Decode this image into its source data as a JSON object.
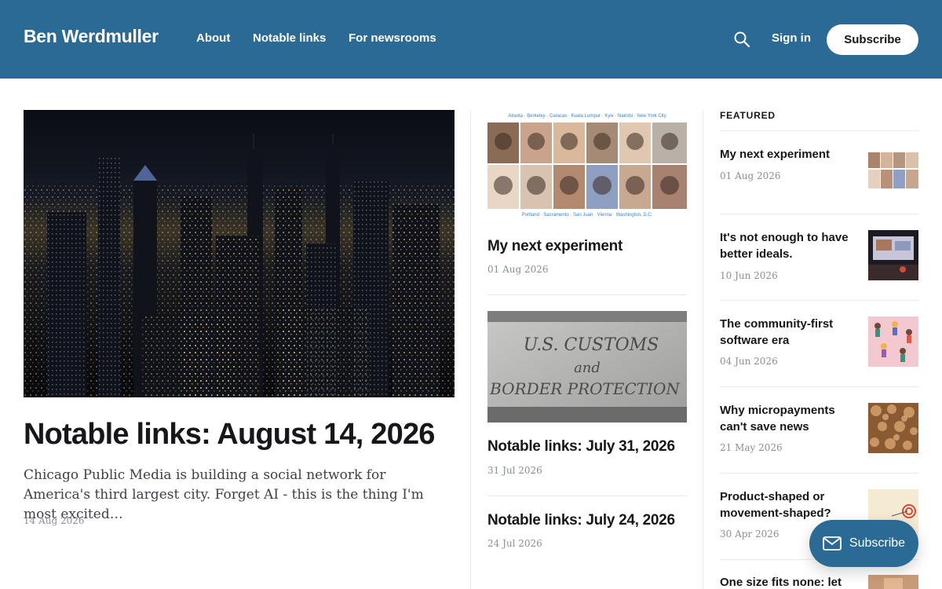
{
  "header": {
    "brand": "Ben Werdmuller",
    "nav": [
      "About",
      "Notable links",
      "For newsrooms"
    ],
    "signin": "Sign in",
    "subscribe": "Subscribe",
    "bg_color": "#2a6a94"
  },
  "main_post": {
    "title": "Notable links: August 14, 2026",
    "excerpt": "Chicago Public Media is building a social network for America's third largest city. Forget AI - this is the thing I'm most excited…",
    "date": "14 Aug 2026",
    "image": "city-skyline-night"
  },
  "middle_posts": [
    {
      "title": "My next experiment",
      "date": "01 Aug 2026",
      "image": "team-portrait-grid",
      "image_caption_top": "Atlanta · Berkeley · Caracas · Kuala Lumpur · Kyiv · Nairobi · New York City",
      "image_caption_bottom": "Portland · Sacramento · San Juan · Vienna · Washington, D.C."
    },
    {
      "title": "Notable links: July 31, 2026",
      "date": "31 Jul 2026",
      "image": "customs-sign",
      "image_text": [
        "U.S. CUSTOMS",
        "and",
        "BORDER PROTECTION"
      ]
    },
    {
      "title": "Notable links: July 24, 2026",
      "date": "24 Jul 2026"
    }
  ],
  "featured": {
    "label": "FEATURED",
    "items": [
      {
        "title": "My next experiment",
        "date": "01 Aug 2026",
        "thumb": "team-portrait-grid"
      },
      {
        "title": "It's not enough to have better ideals.",
        "date": "10 Jun 2026",
        "thumb": "conference-stage"
      },
      {
        "title": "The community-first software era",
        "date": "04 Jun 2026",
        "thumb": "people-illustration"
      },
      {
        "title": "Why micropayments can't save news",
        "date": "21 May 2026",
        "thumb": "coins-pile"
      },
      {
        "title": "Product-shaped or movement-shaped?",
        "date": "30 Apr 2026",
        "thumb": "target-drawing"
      },
      {
        "title": "One size fits none: let",
        "date": "",
        "thumb": "hands"
      }
    ]
  },
  "portal": {
    "label": "Subscribe",
    "icon": "envelope-icon"
  }
}
